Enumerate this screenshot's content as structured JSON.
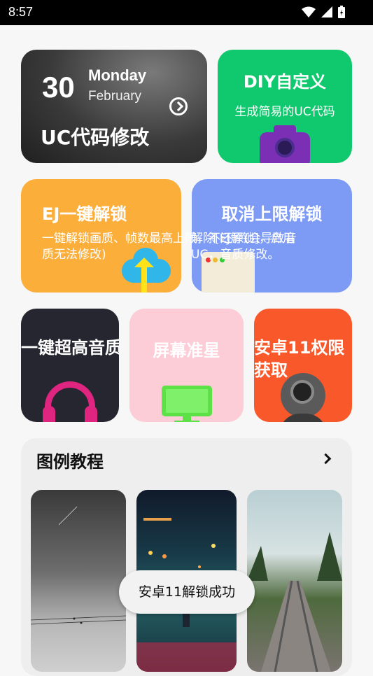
{
  "status_bar": {
    "time": "8:57"
  },
  "date_card": {
    "day_number": "30",
    "weekday": "Monday",
    "month": "February",
    "title": "UC代码修改"
  },
  "diy_card": {
    "title": "DIY自定义",
    "subtitle": "生成简易的UC代码"
  },
  "ej_card": {
    "title": "EJ一键解锁",
    "description": "一键解锁画质、帧数最高上限，不还原(会导致音质无法修改)"
  },
  "cancel_card": {
    "title": "取消上限解锁",
    "description": "解除[EJ解锁]，启用UC，音质修改。"
  },
  "hd_audio_card": {
    "title": "一键超高音质"
  },
  "crosshair_card": {
    "title": "屏幕准星"
  },
  "android_card": {
    "title": "安卓11权限获取"
  },
  "tutorial": {
    "title": "图例教程"
  },
  "toast": {
    "message": "安卓11解锁成功"
  },
  "colors": {
    "green": "#10c96e",
    "orange": "#fcae3a",
    "blue": "#7d9bf5",
    "pink": "#fccdd6",
    "red": "#f9582a",
    "dark": "#262630"
  }
}
